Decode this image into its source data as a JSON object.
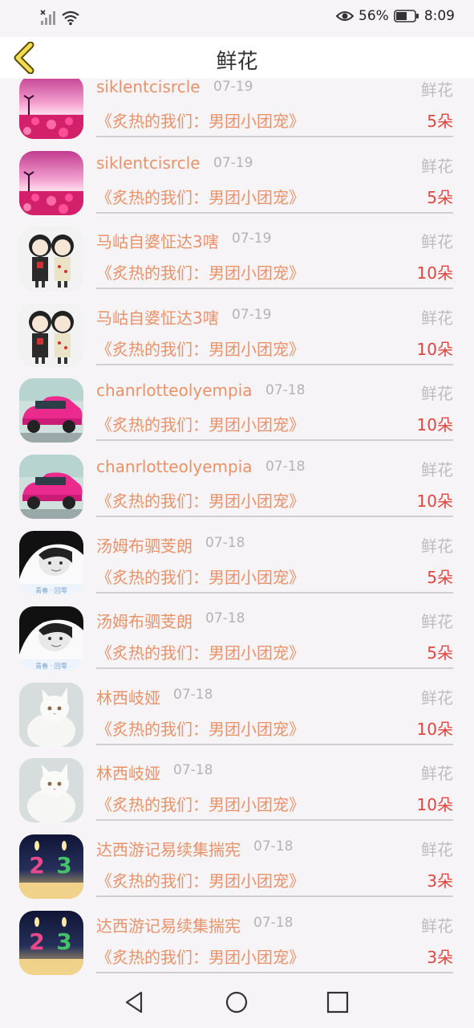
{
  "status_bar": {
    "battery": "56%",
    "time": "8:09"
  },
  "header": {
    "title": "鲜花"
  },
  "rows": [
    {
      "name": "siklentcisrcle",
      "date": "07-19",
      "type": "鲜花",
      "show": "《炙热的我们：男团小团宠》",
      "count": "5朵",
      "avatar": "avatar-sunset"
    },
    {
      "name": "siklentcisrcle",
      "date": "07-19",
      "type": "鲜花",
      "show": "《炙热的我们：男团小团宠》",
      "count": "5朵",
      "avatar": "avatar-sunset"
    },
    {
      "name": "马岵自婆怔达3嗐",
      "date": "07-19",
      "type": "鲜花",
      "show": "《炙热的我们：男团小团宠》",
      "count": "10朵",
      "avatar": "avatar-dolls"
    },
    {
      "name": "马岵自婆怔达3嗐",
      "date": "07-19",
      "type": "鲜花",
      "show": "《炙热的我们：男团小团宠》",
      "count": "10朵",
      "avatar": "avatar-dolls"
    },
    {
      "name": "chanrlotteolyempia",
      "date": "07-18",
      "type": "鲜花",
      "show": "《炙热的我们：男团小团宠》",
      "count": "10朵",
      "avatar": "avatar-pink-car"
    },
    {
      "name": "chanrlotteolyempia",
      "date": "07-18",
      "type": "鲜花",
      "show": "《炙热的我们：男团小团宠》",
      "count": "10朵",
      "avatar": "avatar-pink-car"
    },
    {
      "name": "汤姆布驷芰朗",
      "date": "07-18",
      "type": "鲜花",
      "show": "《炙热的我们：男团小团宠》",
      "count": "5朵",
      "avatar": "avatar-bw-girl"
    },
    {
      "name": "汤姆布驷芰朗",
      "date": "07-18",
      "type": "鲜花",
      "show": "《炙热的我们：男团小团宠》",
      "count": "5朵",
      "avatar": "avatar-bw-girl"
    },
    {
      "name": "林西岐娅",
      "date": "07-18",
      "type": "鲜花",
      "show": "《炙热的我们：男团小团宠》",
      "count": "10朵",
      "avatar": "avatar-white-cat"
    },
    {
      "name": "林西岐娅",
      "date": "07-18",
      "type": "鲜花",
      "show": "《炙热的我们：男团小团宠》",
      "count": "10朵",
      "avatar": "avatar-white-cat"
    },
    {
      "name": "达西游记易续集揣宪",
      "date": "07-18",
      "type": "鲜花",
      "show": "《炙热的我们：男团小团宠》",
      "count": "3朵",
      "avatar": "avatar-candles"
    },
    {
      "name": "达西游记易续集揣宪",
      "date": "07-18",
      "type": "鲜花",
      "show": "《炙热的我们：男团小团宠》",
      "count": "3朵",
      "avatar": "avatar-candles"
    }
  ]
}
